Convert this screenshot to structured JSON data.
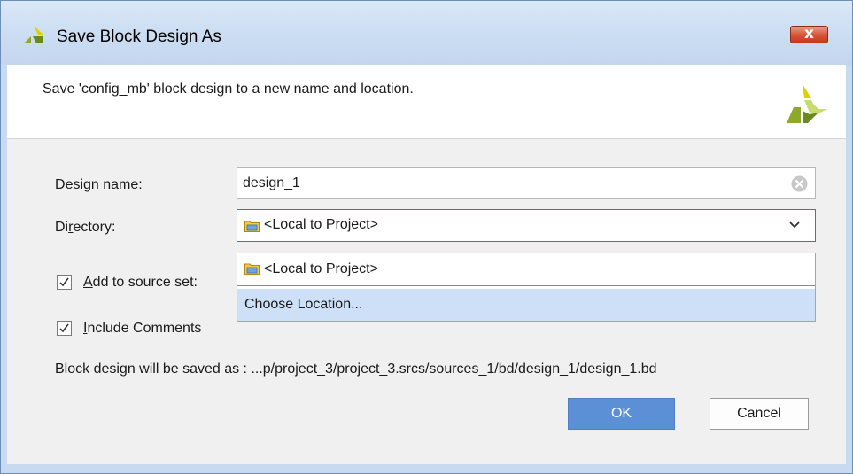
{
  "window": {
    "title": "Save Block Design As",
    "close_label": "x"
  },
  "header": {
    "message": "Save 'config_mb' block design to a new name and location."
  },
  "form": {
    "design_name_label_first": "D",
    "design_name_label_rest": "esign name:",
    "design_name_value": "design_1",
    "directory_label_first": "Di",
    "directory_label_u": "r",
    "directory_label_rest": "ectory:",
    "directory_value": "<Local to Project>",
    "add_to_source_label_u": "A",
    "add_to_source_label_rest": "dd to source set:",
    "add_to_source_checked": true,
    "include_comments_label_u": "I",
    "include_comments_label_rest": "nclude Comments",
    "include_comments_checked": true,
    "saved_as_text": "Block design will be saved as : ...p/project_3/project_3.srcs/sources_1/bd/design_1/design_1.bd"
  },
  "dropdown": {
    "options": [
      {
        "label": "<Local to Project>",
        "icon": "folder-icon"
      },
      {
        "label": "Choose Location...",
        "highlighted": true
      }
    ]
  },
  "buttons": {
    "ok": "OK",
    "cancel": "Cancel"
  },
  "colors": {
    "accent": "#5b8fd6",
    "highlight": "#cde0f7",
    "logo_green": "#8fa82b",
    "logo_yellow": "#e0d000"
  }
}
